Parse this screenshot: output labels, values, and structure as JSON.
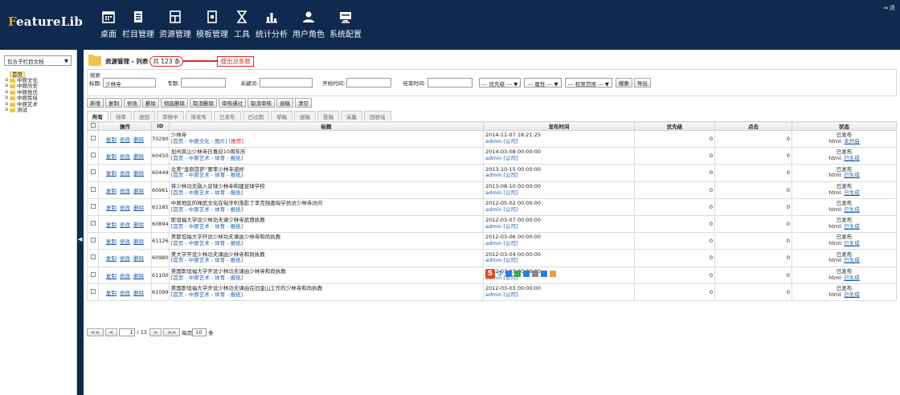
{
  "app": {
    "logo_first": "F",
    "logo_rest": "eatureLib",
    "logout": "退"
  },
  "nav": [
    {
      "label": "桌面",
      "icon": "calendar-icon"
    },
    {
      "label": "栏目管理",
      "icon": "document-icon"
    },
    {
      "label": "资源管理",
      "icon": "folder-tree-icon"
    },
    {
      "label": "模板管理",
      "icon": "template-icon"
    },
    {
      "label": "工具",
      "icon": "hourglass-icon"
    },
    {
      "label": "统计分析",
      "icon": "bar-chart-icon"
    },
    {
      "label": "用户角色",
      "icon": "user-icon"
    },
    {
      "label": "系统配置",
      "icon": "monitor-icon"
    }
  ],
  "sidebar": {
    "select": "包含子栏目文档",
    "tree": [
      {
        "label": "首页",
        "root": true
      },
      {
        "label": "中原文化"
      },
      {
        "label": "中原历史"
      },
      {
        "label": "中原姓氏"
      },
      {
        "label": "中原民俗"
      },
      {
        "label": "中原艺术"
      },
      {
        "label": "测试"
      }
    ]
  },
  "page": {
    "title": "资源管理 - 列表",
    "count_prefix": "共",
    "count": "123",
    "count_suffix": "条",
    "annotation": "搜出总条数"
  },
  "search": {
    "legend": "搜索",
    "title_label": "标题:",
    "title_value": "少林寺",
    "editor_label": "专题:",
    "keyword_label": "关键词:",
    "start_label": "开始时间:",
    "end_label": "结束时间:",
    "priority": "--- 优先级 ---",
    "attribute": "--- 属性 ---",
    "scope": "--- 权限范围 ---",
    "search_btn": "搜索",
    "export_btn": "导出"
  },
  "toolbar": [
    "新增",
    "复制",
    "修改",
    "删除",
    "彻底删除",
    "取消删除",
    "审核通过",
    "取消审核",
    "退稿",
    "清空"
  ],
  "tabs": [
    "所有",
    "待审",
    "退回",
    "审核中",
    "待发布",
    "已发布",
    "已过期",
    "草稿",
    "退稿",
    "投稿",
    "采集",
    "回收站"
  ],
  "columns": {
    "ops": "操作",
    "id": "ID",
    "title": "标题",
    "time": "发布时间",
    "priority": "优先级",
    "clicks": "点击",
    "status": "状态"
  },
  "row_ops": {
    "copy": "复制",
    "edit": "修改",
    "del": "删除"
  },
  "rows": [
    {
      "id": "70290",
      "title": "少林寺",
      "path": "[首页 - 中原文化 - 图片]",
      "hot": "[推荐]",
      "time": "2014-11-07 18:21:25",
      "pub": "admin [公司]",
      "priority": "0",
      "clicks": "0",
      "status": "已发布",
      "html_label": "html:",
      "html": "未开启"
    },
    {
      "id": "60450",
      "title": "加州嵩山少林寺日喜迎10周年庆",
      "path": "[首页 - 中原艺术 - 体育 - 报纸]",
      "hot": "",
      "time": "2014-03-08 00:00:00",
      "pub": "admin [公司]",
      "priority": "0",
      "clicks": "0",
      "status": "已发布",
      "html_label": "html:",
      "html": "已生成"
    },
    {
      "id": "60449",
      "title": "北美“金刚菩萨”要率少林寺道修",
      "path": "[首页 - 中原艺术 - 体育 - 报纸]",
      "hot": "",
      "time": "2013-10-15 00:00:00",
      "pub": "admin [公司]",
      "priority": "0",
      "clicks": "0",
      "status": "已发布",
      "html_label": "html:",
      "html": "已生成"
    },
    {
      "id": "60961",
      "title": "将少林功夫融入足球少林寺和建足球学校",
      "path": "[首页 - 中原艺术 - 体育 - 报纸]",
      "hot": "",
      "time": "2013-08-10 00:00:00",
      "pub": "admin [公司]",
      "priority": "0",
      "clicks": "0",
      "status": "已发布",
      "html_label": "html:",
      "html": "已生成"
    },
    {
      "id": "61185",
      "title": "中原地区的禅武文化在匈牙利落影了李克强邀匈学员访少林寺访问",
      "path": "[首页 - 中原艺术 - 体育 - 报纸]",
      "hot": "",
      "time": "2012-05-02 00:00:00",
      "pub": "admin [公司]",
      "priority": "0",
      "clicks": "0",
      "status": "已发布",
      "html_label": "html:",
      "html": "已生成"
    },
    {
      "id": "60894",
      "title": "斯坦福大学设少林功夫课少林寺武僧执教",
      "path": "[首页 - 中原艺术 - 体育 - 报纸]",
      "hot": "",
      "time": "2012-03-07 00:00:00",
      "pub": "admin [公司]",
      "priority": "0",
      "clicks": "0",
      "status": "已发布",
      "html_label": "html:",
      "html": "已生成"
    },
    {
      "id": "61126",
      "title": "美斯坦福大学开设少林功夫课由少林寺和尚执教",
      "path": "[首页 - 中原艺术 - 体育 - 报纸]",
      "hot": "",
      "time": "2012-03-06 00:00:00",
      "pub": "admin [公司]",
      "priority": "0",
      "clicks": "0",
      "status": "已发布",
      "html_label": "html:",
      "html": "已生成"
    },
    {
      "id": "60980",
      "title": "美大学开设少林功夫课由少林寺和尚执教",
      "path": "[首页 - 中原艺术 - 体育 - 报纸]",
      "hot": "",
      "time": "2012-03-04 00:00:00",
      "pub": "admin [公司]",
      "priority": "0",
      "clicks": "0",
      "status": "已发布",
      "html_label": "html:",
      "html": "已生成"
    },
    {
      "id": "61100",
      "title": "美国斯坦福大学开设少林功夫课由少林寺和尚执教",
      "path": "[首页 - 中原艺术 - 体育 - 报纸]",
      "hot": "",
      "time": "2012-03-03 00:00:00",
      "pub": "admin [公司]",
      "priority": "0",
      "clicks": "0",
      "status": "已发布",
      "html_label": "html:",
      "html": "已生成"
    },
    {
      "id": "61099",
      "title": "美国斯坦福大学开设少林功夫课由在旧金山工作的少林寺和尚执教",
      "path": "[首页 - 中原艺术 - 体育 - 报纸]",
      "hot": "",
      "time": "2012-03-03 00:00:00",
      "pub": "admin [公司]",
      "priority": "0",
      "clicks": "0",
      "status": "已发布",
      "html_label": "html:",
      "html": "已生成"
    }
  ],
  "pager": {
    "first": "<<",
    "prev": "<",
    "page": "1",
    "total": "/ 13",
    "next": ">",
    "last": ">>",
    "per_label": "每页",
    "per_value": "10",
    "per_unit": "条"
  },
  "ime": {
    "label": "中",
    "icon": "sogou-ime-icon"
  }
}
